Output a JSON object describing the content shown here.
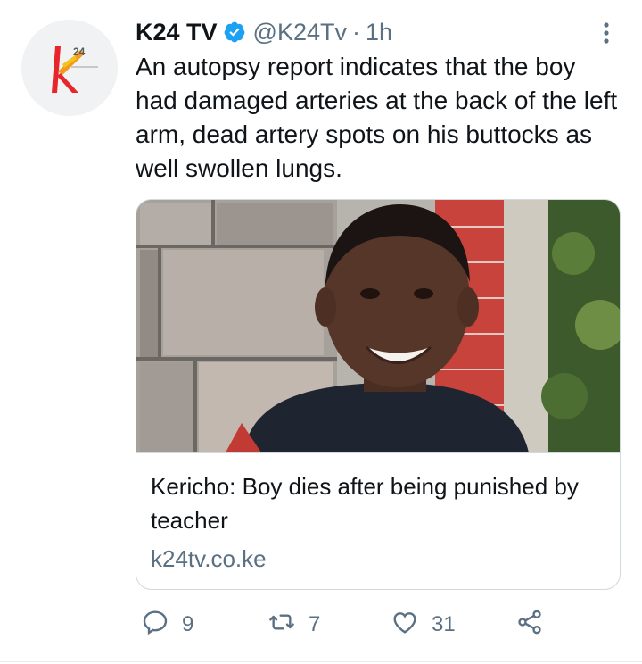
{
  "tweet": {
    "display_name": "K24 TV",
    "handle": "@K24Tv",
    "separator": "·",
    "time": "1h",
    "text": "An autopsy report indicates that the boy had damaged arteries at the back of the left arm, dead artery spots on his buttocks as well swollen lungs.",
    "avatar_logo_text": "24"
  },
  "card": {
    "title": "Kericho: Boy dies after being punished by teacher",
    "domain": "k24tv.co.ke"
  },
  "actions": {
    "reply_count": "9",
    "retweet_count": "7",
    "like_count": "31"
  },
  "icons": {
    "verified": "verified-badge-icon",
    "more": "more-vertical-icon",
    "reply": "reply-icon",
    "retweet": "retweet-icon",
    "like": "heart-icon",
    "share": "share-icon"
  },
  "colors": {
    "accent": "#1da1f2",
    "secondary_text": "#5b7083",
    "primary_text": "#0f1419",
    "border": "#cfd9de"
  }
}
